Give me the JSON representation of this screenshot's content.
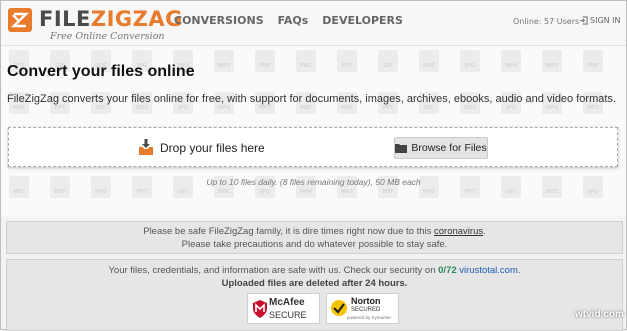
{
  "brand": {
    "name_part1": "FILE",
    "name_part2": "ZIGZAG",
    "tagline": "Free Online Conversion",
    "accent_color": "#e87b2c"
  },
  "nav": {
    "items": [
      {
        "label": "CONVERSIONS"
      },
      {
        "label": "FAQs"
      },
      {
        "label": "DEVELOPERS"
      }
    ]
  },
  "header": {
    "online_users": "Online: 57 Users",
    "sign_in": "SIGN IN"
  },
  "main": {
    "title": "Convert your files online",
    "description": "FileZigZag converts your files online for free, with support for documents, images, archives, ebooks, audio and video formats.",
    "drop_label": "Drop your files here",
    "browse_label": "Browse for Files",
    "limits": "Up to 10 files daily. (8 files remaining today), 50 MB each"
  },
  "notice_coronavirus": {
    "line1_prefix": "Please be safe FileZigZag family, it is dire times right now due to this ",
    "line1_link": "coronavirus",
    "line1_suffix": ".",
    "line2": "Please take precautions and do whatever possible to stay safe."
  },
  "notice_security": {
    "line1_prefix": "Your files, credentials, and information are safe with us. Check our security on ",
    "score": "0/72",
    "site": "virustotal.com",
    "line1_suffix": ".",
    "line2": "Uploaded files are deleted after 24 hours.",
    "mcafee_brand": "McAfee",
    "mcafee_secure": "SECURE",
    "norton_brand": "Norton",
    "norton_secured": "SECURED",
    "norton_powered": "powered by Symantec"
  },
  "watermark": "wtvid.com",
  "background_icon_labels": [
    "PPT",
    "GIF",
    "DOC",
    "JPG",
    "MP4",
    "MP3",
    "PDF",
    "PNG"
  ]
}
